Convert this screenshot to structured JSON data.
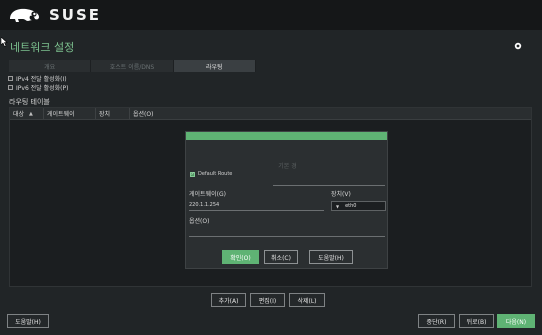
{
  "header": {
    "brand": "SUSE",
    "logo_icon": "suse-chameleon-logo"
  },
  "page": {
    "title": "네트워크 설정"
  },
  "tabs": [
    {
      "label": "개요"
    },
    {
      "label": "호스트 이름/DNS"
    },
    {
      "label": "라우팅"
    }
  ],
  "options": {
    "ipv4_forwarding": "IPv4 전달 활성화(I)",
    "ipv6_forwarding": "IPv6 전달 활성화(P)"
  },
  "routing_table": {
    "label": "라우팅 테이블",
    "columns": [
      "대상",
      "게이트웨이",
      "장치",
      "옵션(O)"
    ]
  },
  "dialog": {
    "title": "기본 경",
    "default_route_label": "Default Route",
    "default_route_checked": true,
    "gateway_label": "게이트웨이(G)",
    "gateway_value": "220.1.1.254",
    "device_label": "장치(V)",
    "device_value": "eth0",
    "options_label": "옵션(O)",
    "buttons": {
      "ok": "확인(O)",
      "cancel": "취소(C)",
      "help": "도움말(H)"
    }
  },
  "table_actions": {
    "add": "추가(A)",
    "edit": "편집(I)",
    "delete": "삭제(L)"
  },
  "footer": {
    "help": "도움말(H)",
    "abort": "중단(R)",
    "back": "뒤로(B)",
    "next": "다음(N)"
  },
  "colors": {
    "accent": "#5fb374",
    "title": "#7cc08e",
    "background": "#212527"
  }
}
